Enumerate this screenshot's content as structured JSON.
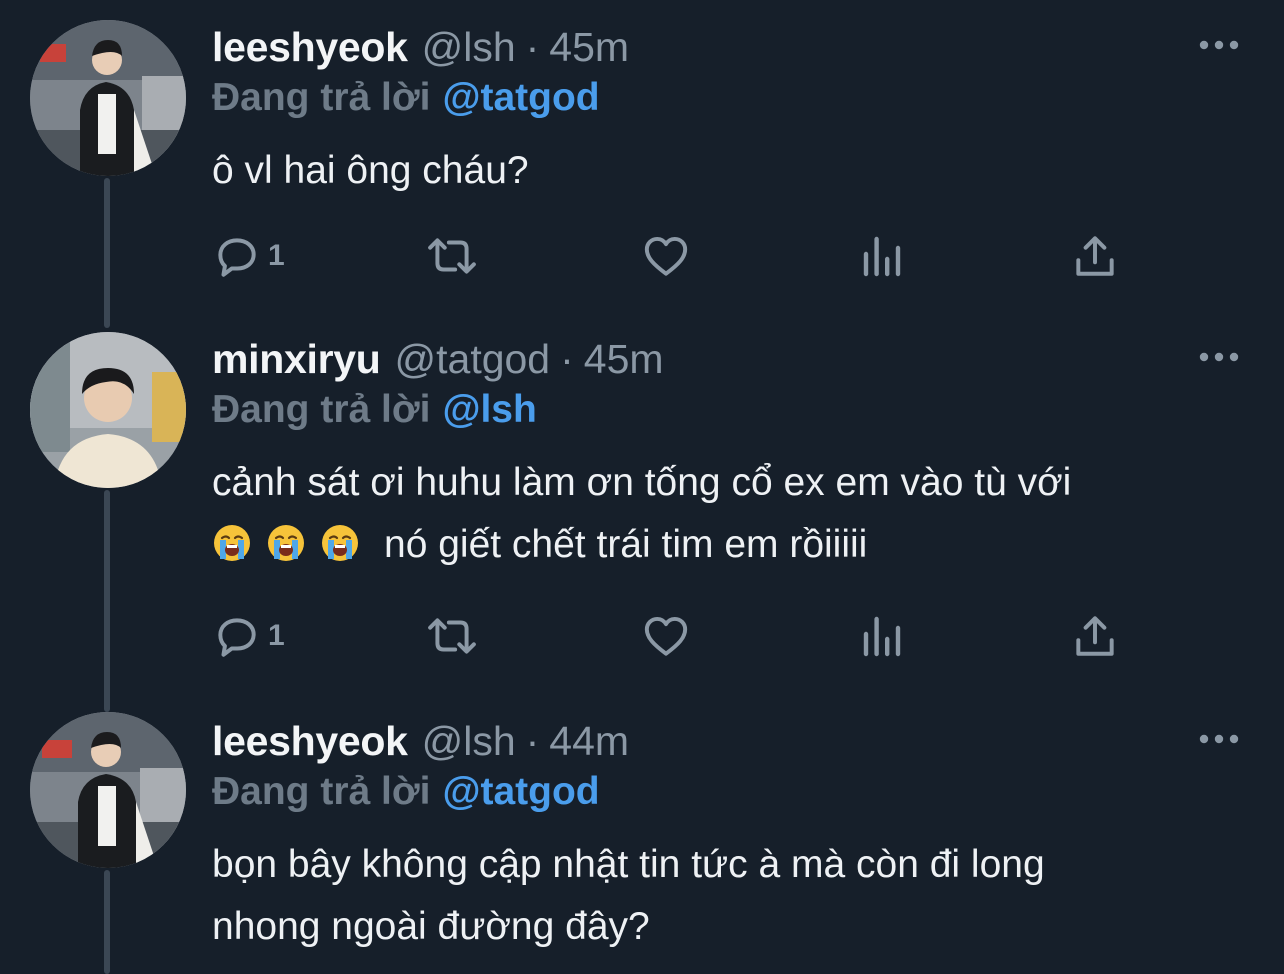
{
  "thread": {
    "tweets": [
      {
        "display_name": "leeshyeok",
        "handle": "@lsh",
        "separator": "·",
        "time": "45m",
        "reply_prefix": "Đang trả lời",
        "reply_to": "@tatgod",
        "body_lines": [
          "ô vl hai ông cháu?"
        ],
        "reply_count": "1"
      },
      {
        "display_name": "minxiryu",
        "handle": "@tatgod",
        "separator": "·",
        "time": "45m",
        "reply_prefix": "Đang trả lời",
        "reply_to": "@lsh",
        "body_lines": [
          "cảnh sát ơi huhu làm ơn tống cổ ex em vào tù với"
        ],
        "body_emoji_line": {
          "emoji": [
            "loudly-crying-face",
            "loudly-crying-face",
            "loudly-crying-face"
          ],
          "text": "nó giết chết trái tim em rồiiiii"
        },
        "reply_count": "1"
      },
      {
        "display_name": "leeshyeok",
        "handle": "@lsh",
        "separator": "·",
        "time": "44m",
        "reply_prefix": "Đang trả lời",
        "reply_to": "@tatgod",
        "body_lines": [
          "bọn bây không cập nhật tin tức à mà còn đi long",
          "nhong ngoài đường đây?"
        ]
      }
    ]
  },
  "icons": {
    "reply": "reply-icon",
    "retweet": "retweet-icon",
    "like": "heart-icon",
    "analytics": "analytics-icon",
    "share": "share-icon",
    "more": "more-icon"
  },
  "colors": {
    "background": "#161f2a",
    "mention": "#4a9dec",
    "muted": "#8b98a5",
    "thread_line": "#3b4754"
  }
}
